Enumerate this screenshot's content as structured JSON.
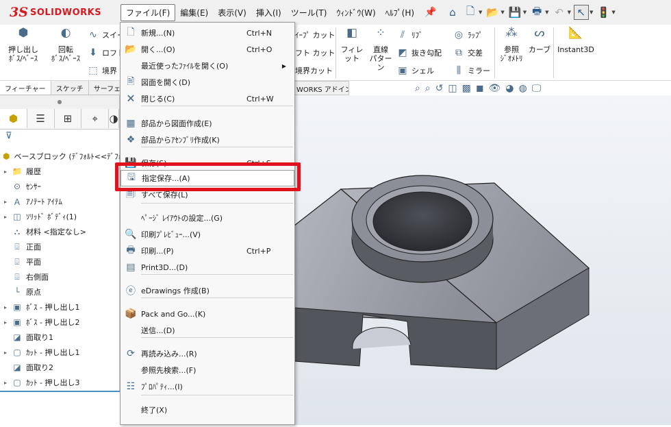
{
  "app": {
    "logo_ds": "3S",
    "logo_text": "SOLIDWORKS",
    "brand_color": "#d71920",
    "highlight_color": "#e0121e"
  },
  "menubar": {
    "items": [
      "ファイル(F)",
      "編集(E)",
      "表示(V)",
      "挿入(I)",
      "ツール(T)",
      "ｳｨﾝﾄﾞｳ(W)",
      "ﾍﾙﾌﾟ(H)"
    ]
  },
  "quick_access": {
    "icons": [
      "home-icon",
      "new-icon",
      "open-icon",
      "save-icon",
      "print-icon",
      "undo-icon",
      "select-icon",
      "rebuild-icon"
    ]
  },
  "ribbon": {
    "extrude": "押し出し\nﾎﾞｽ/ﾍﾞｰｽ",
    "revolve": "回転\nﾎﾞｽ/ﾍﾞｰｽ",
    "sweep": "スイー",
    "loft": "ロフト",
    "boundary": "境界",
    "sweep_cut": "ｲｰﾌﾟ カット",
    "loft_cut": "フト カット",
    "boundary_cut": "境界カット",
    "fillet": "フィレット",
    "linear_pattern": "直線\nパターン",
    "rib": "ﾘﾌﾞ",
    "draft": "抜き勾配",
    "shell": "シェル",
    "wrap": "ﾗｯﾌﾟ",
    "intersect": "交差",
    "mirror": "ミラー",
    "ref_geom": "参照\nｼﾞｵﾒﾄﾘ",
    "curves": "カーブ",
    "instant3d": "Instant3D"
  },
  "tabs": [
    "フィーチャー",
    "スケッチ",
    "サーフェス"
  ],
  "tab_right": "WORKS アドイン",
  "panel": {
    "root": "ベースブロック (ﾃﾞﾌｫﾙﾄ<<ﾃﾞﾌｫ",
    "items": [
      {
        "label": "履歴",
        "exp": true,
        "icon": "history-icon"
      },
      {
        "label": "ｾﾝｻｰ",
        "exp": false,
        "icon": "sensor-icon"
      },
      {
        "label": "ｱﾉﾃｰﾄ ｱｲﾃﾑ",
        "exp": true,
        "icon": "annotation-icon"
      },
      {
        "label": "ｿﾘｯﾄﾞ ﾎﾞﾃﾞｨ(1)",
        "exp": true,
        "icon": "solid-body-icon"
      },
      {
        "label": "材料 <指定なし>",
        "exp": false,
        "icon": "material-icon"
      },
      {
        "label": "正面",
        "exp": false,
        "icon": "plane-icon"
      },
      {
        "label": "平面",
        "exp": false,
        "icon": "plane-icon"
      },
      {
        "label": "右側面",
        "exp": false,
        "icon": "plane-icon"
      },
      {
        "label": "原点",
        "exp": false,
        "icon": "origin-icon"
      },
      {
        "label": "ﾎﾞｽ - 押し出し1",
        "exp": true,
        "icon": "boss-extrude-icon"
      },
      {
        "label": "ﾎﾞｽ - 押し出し2",
        "exp": true,
        "icon": "boss-extrude-icon"
      },
      {
        "label": "面取り1",
        "exp": false,
        "icon": "chamfer-icon"
      },
      {
        "label": "ｶｯﾄ - 押し出し1",
        "exp": true,
        "icon": "cut-extrude-icon"
      },
      {
        "label": "面取り2",
        "exp": false,
        "icon": "chamfer-icon"
      },
      {
        "label": "ｶｯﾄ - 押し出し3",
        "exp": true,
        "icon": "cut-extrude-icon"
      }
    ]
  },
  "file_menu": {
    "items": [
      {
        "label": "新規...(N)",
        "key": "Ctrl+N",
        "icon": "new-icon"
      },
      {
        "label": "開く...(O)",
        "key": "Ctrl+O",
        "icon": "open-icon"
      },
      {
        "label": "最近使ったﾌｧｲﾙを開く(O)",
        "key": "",
        "icon": "",
        "submenu": true
      },
      {
        "label": "図面を開く(D)",
        "key": "",
        "icon": "drawing-icon"
      },
      {
        "label": "閉じる(C)",
        "key": "Ctrl+W",
        "icon": "close-icon"
      },
      {
        "label": "部品から図面作成(E)",
        "key": "",
        "icon": "make-drawing-icon"
      },
      {
        "label": "部品からｱｾﾝﾌﾞﾘ作成(K)",
        "key": "",
        "icon": "make-assembly-icon"
      },
      {
        "label": "保存(S)",
        "key": "Ctrl+S",
        "icon": "save-icon"
      },
      {
        "label": "指定保存...(A)",
        "key": "",
        "icon": "save-as-icon"
      },
      {
        "label": "すべて保存(L)",
        "key": "",
        "icon": "save-all-icon"
      },
      {
        "label": "ﾍﾟｰｼﾞ ﾚｲｱｳﾄの設定...(G)",
        "key": "",
        "icon": ""
      },
      {
        "label": "印刷ﾌﾟﾚﾋﾞｭｰ...(V)",
        "key": "",
        "icon": "print-preview-icon"
      },
      {
        "label": "印刷...(P)",
        "key": "Ctrl+P",
        "icon": "print-icon"
      },
      {
        "label": "Print3D...(D)",
        "key": "",
        "icon": "print3d-icon"
      },
      {
        "label": "eDrawings 作成(B)",
        "key": "",
        "icon": "edrawings-icon"
      },
      {
        "label": "Pack and Go...(K)",
        "key": "",
        "icon": "pack-and-go-icon"
      },
      {
        "label": "送信...(D)",
        "key": "",
        "icon": ""
      },
      {
        "label": "再読み込み...(R)",
        "key": "",
        "icon": "reload-icon"
      },
      {
        "label": "参照先検索...(F)",
        "key": "",
        "icon": ""
      },
      {
        "label": "ﾌﾟﾛﾊﾟﾃｨ...(I)",
        "key": "",
        "icon": "properties-icon"
      },
      {
        "label": "終了(X)",
        "key": "",
        "icon": ""
      }
    ]
  }
}
